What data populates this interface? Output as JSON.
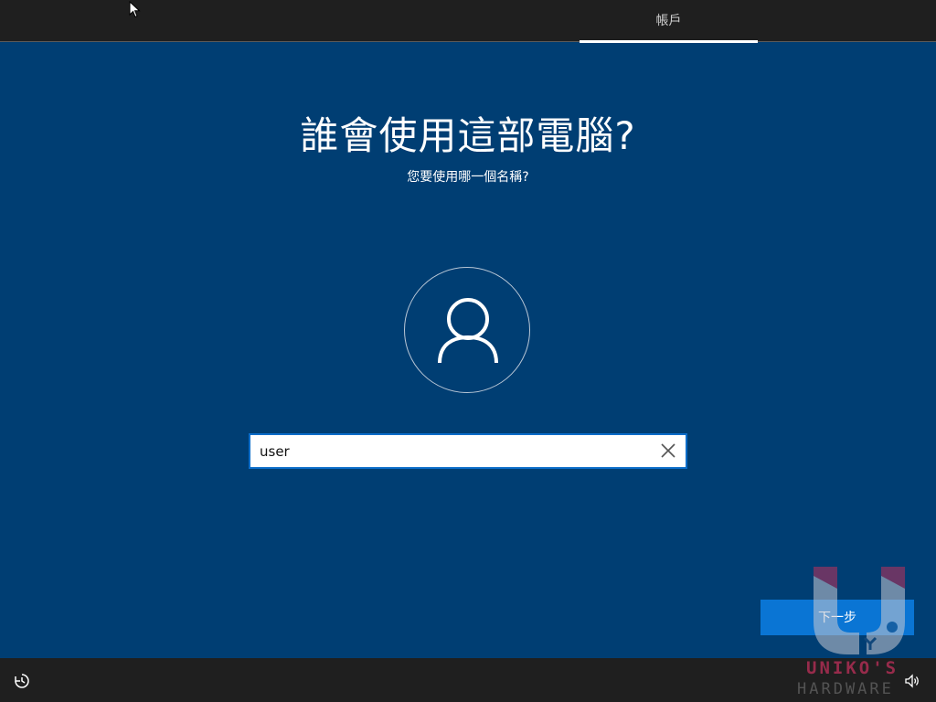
{
  "header": {
    "tab_label": "帳戶"
  },
  "main": {
    "title": "誰會使用這部電腦?",
    "subtitle": "您要使用哪一個名稱?",
    "username_value": "user",
    "next_label": "下一步"
  },
  "watermark": {
    "line1": "UNIKO'S",
    "line2": "HARDWARE"
  },
  "icons": {
    "avatar": "person-icon",
    "clear": "close-icon",
    "ease_of_access": "ease-of-access-icon",
    "volume": "volume-icon",
    "cursor": "mouse-cursor-icon"
  },
  "colors": {
    "background": "#003e73",
    "bar": "#1f1f1f",
    "accent": "#0a75d4",
    "input_border": "#0a6cc8"
  }
}
